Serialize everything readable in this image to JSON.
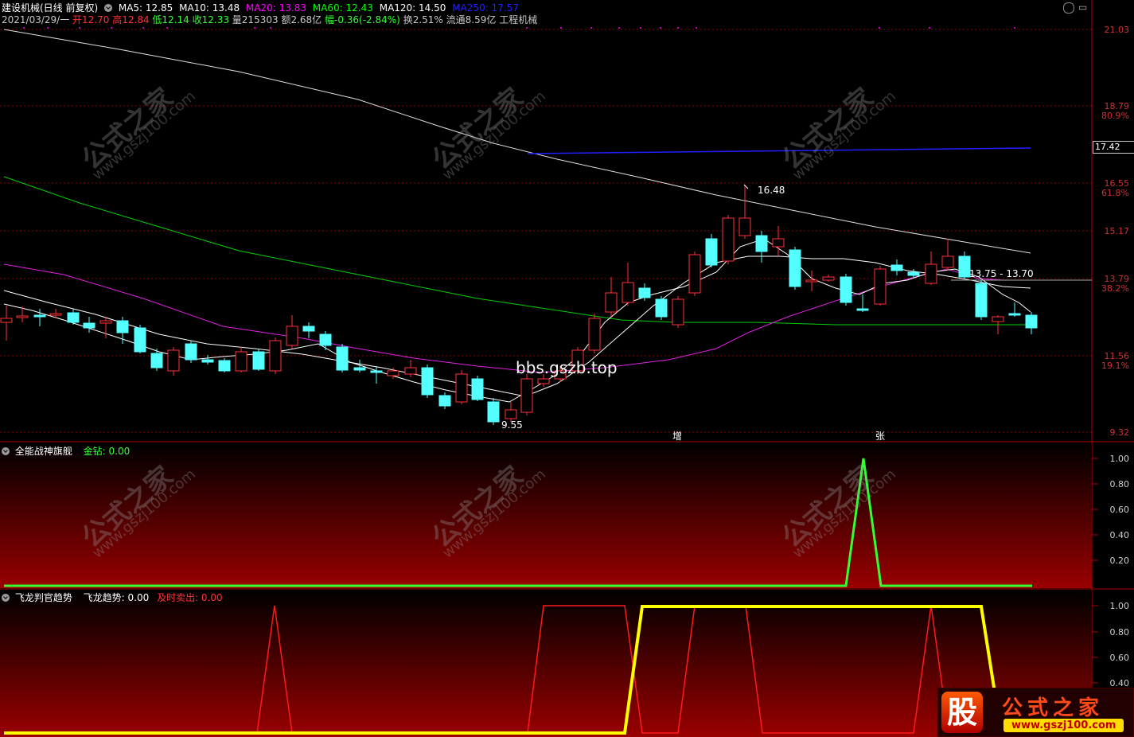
{
  "header": {
    "stock": "建设机械(日线 前复权)",
    "ma5": "MA5: 12.85",
    "ma10": "MA10: 13.48",
    "ma20": "MA20: 13.83",
    "ma60": "MA60: 12.43",
    "ma120": "MA120: 14.50",
    "ma250": "MA250: 17.57",
    "date": "2021/03/29/一",
    "open": "开12.70",
    "high": "高12.84",
    "low": "低12.14",
    "close": "收12.33",
    "vol": "量215303",
    "amount": "额2.68亿",
    "change": "幅-0.36(-2.84%)",
    "turnover": "换2.51%",
    "float": "流通8.59亿",
    "industry": "工程机械"
  },
  "main_chart": {
    "price_axis": [
      {
        "v": "21.03",
        "p": ""
      },
      {
        "v": "18.79",
        "p": "80.9%"
      },
      {
        "v": "16.55",
        "p": "61.8%"
      },
      {
        "v": "15.17",
        "p": ""
      },
      {
        "v": "13.79",
        "p": "38.2%"
      },
      {
        "v": "11.56",
        "p": "19.1%"
      },
      {
        "v": "9.32",
        "p": ""
      }
    ],
    "axis_box": "17.42",
    "annotations": {
      "high": "16.48",
      "low": "9.55",
      "line": "13.75 - 13.70",
      "mark1": "增",
      "mark2": "张"
    },
    "center_watermark": "bbs.gszb.top"
  },
  "panel1": {
    "title": "全能战神旗舰",
    "series": "金钻: 0.00",
    "axis": [
      "1.00",
      "0.80",
      "0.60",
      "0.40",
      "0.20"
    ]
  },
  "panel2": {
    "title": "飞龙判官趋势",
    "series1": "飞龙趋势: 0.00",
    "series2": "及时卖出: 0.00",
    "axis": [
      "1.00",
      "0.80",
      "0.60",
      "0.40"
    ]
  },
  "watermark": {
    "text": "公式之家",
    "url": "www.gszj100.com"
  },
  "logo": {
    "icon": "股",
    "title": "公式之家",
    "url": "www.gszj100.com"
  },
  "colors": {
    "up": "#ff3232",
    "down": "#54ffff",
    "ma5": "#ffffff",
    "ma20": "#ff00ff",
    "ma60": "#00ff00",
    "ma250": "#0000ff",
    "ma120": "#ffffff",
    "gold": "#32ff32",
    "trend": "#ffff00",
    "sell": "#ff0000"
  }
}
